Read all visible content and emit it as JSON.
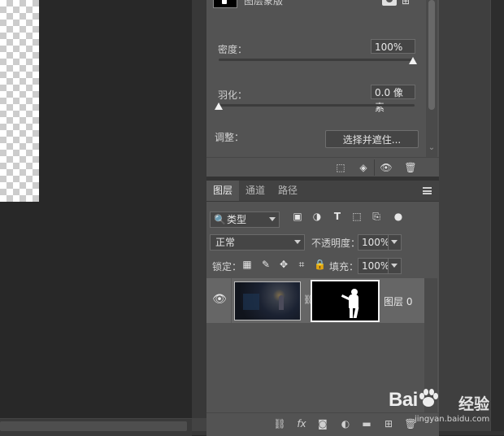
{
  "properties": {
    "mask_label": "图层蒙版",
    "density": {
      "label": "密度：",
      "value": "100%",
      "level": 1.0
    },
    "feather": {
      "label": "羽化：",
      "value": "0.0 像素",
      "level": 0.0
    },
    "adjust_label": "调整：",
    "refine_button": "选择并遮住..."
  },
  "layers_panel": {
    "tabs": [
      {
        "label": "图层",
        "active": true
      },
      {
        "label": "通道",
        "active": false
      },
      {
        "label": "路径",
        "active": false
      }
    ],
    "filter": {
      "icon": "search-icon",
      "value": "类型"
    },
    "blend_mode": "正常",
    "opacity": {
      "label": "不透明度：",
      "value": "100%"
    },
    "lock_label": "锁定：",
    "fill": {
      "label": "填充：",
      "value": "100%"
    },
    "layers": [
      {
        "name": "图层 0",
        "visible": true,
        "has_mask": true
      }
    ]
  },
  "watermark": {
    "brand": "Bai",
    "brand_cn": "经验",
    "domain": "jingyan.baidu.com"
  },
  "colors": {
    "panel": "#535353",
    "canvas_bg": "#282828",
    "selected_row": "#666666"
  }
}
